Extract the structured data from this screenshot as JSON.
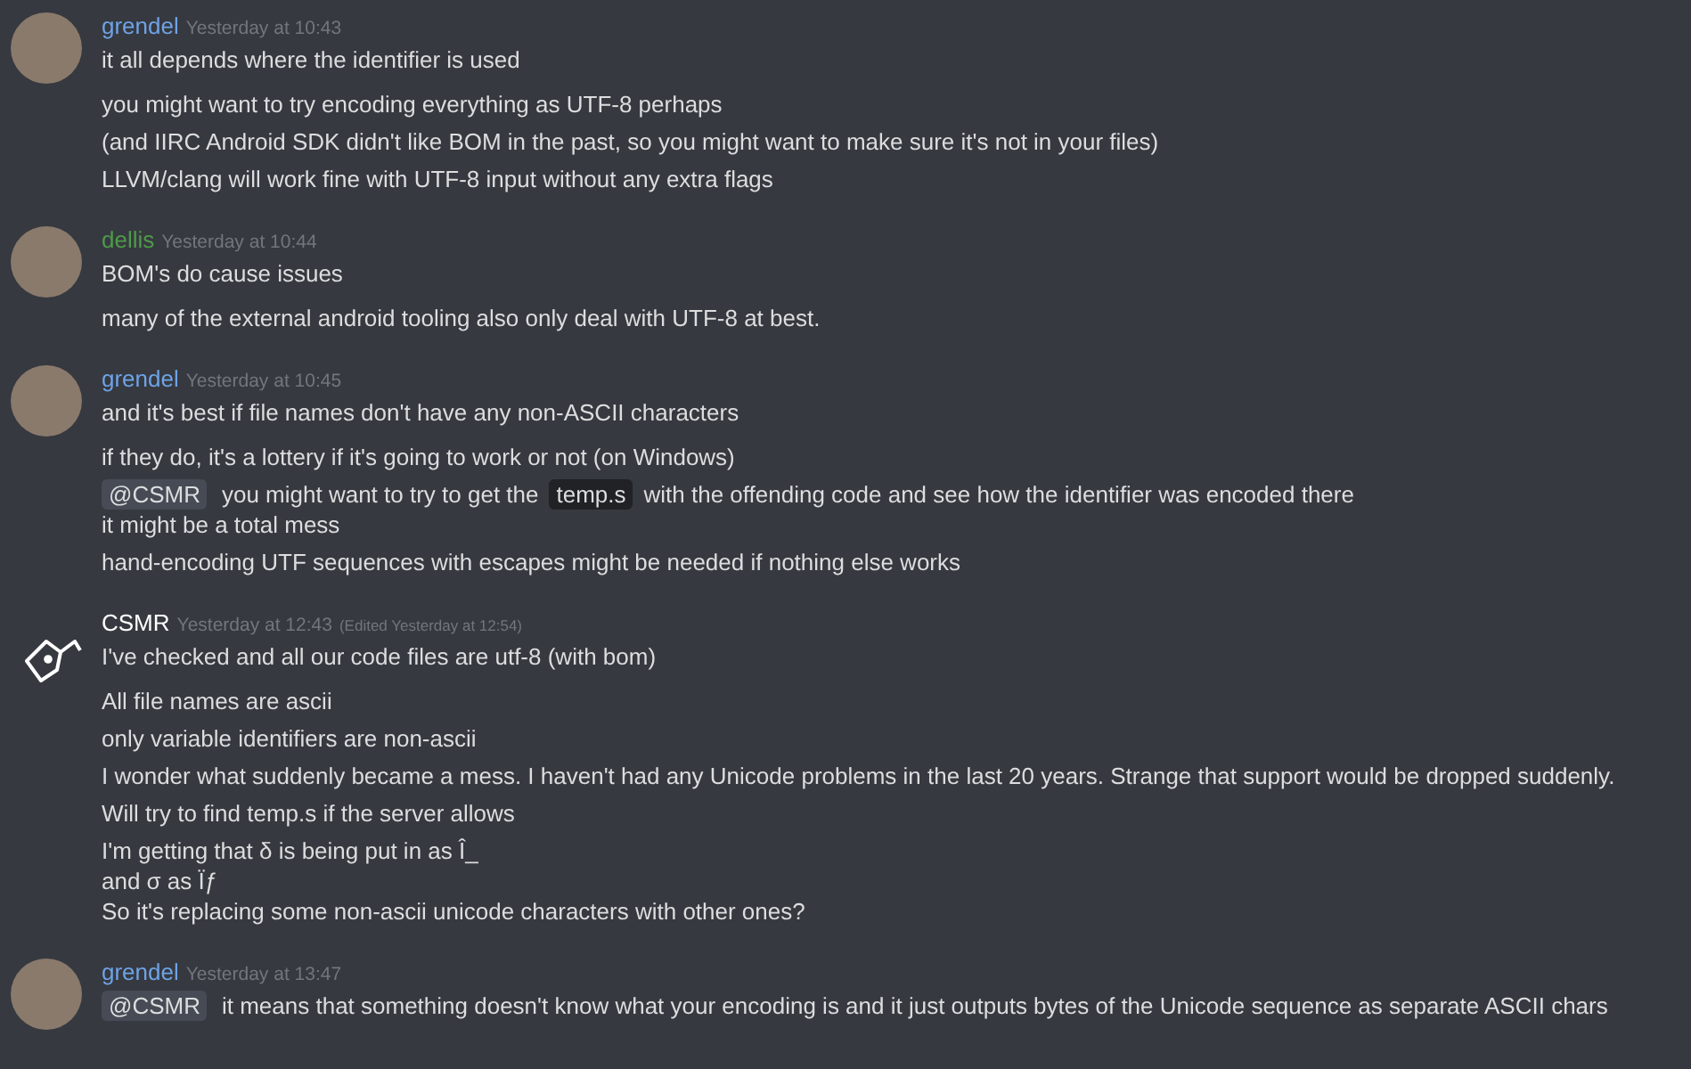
{
  "messages": [
    {
      "author": "grendel",
      "color": "#6ea3e8",
      "avatar": {
        "kind": "photo"
      },
      "timestamp": "Yesterday at 10:43",
      "paragraphs": [
        [
          [
            {
              "kind": "text",
              "text": "it all depends where the identifier is used"
            }
          ]
        ],
        [
          [
            {
              "kind": "text",
              "text": "you might want to try encoding everything as UTF-8 perhaps"
            }
          ]
        ],
        [
          [
            {
              "kind": "text",
              "text": "(and IIRC Android SDK didn't like BOM in the past, so you might want to make sure it's not in your files)"
            }
          ]
        ],
        [
          [
            {
              "kind": "text",
              "text": "LLVM/clang will work fine with UTF-8 input without any extra flags"
            }
          ]
        ]
      ]
    },
    {
      "author": "dellis",
      "color": "#4e9a4a",
      "avatar": {
        "kind": "photo"
      },
      "timestamp": "Yesterday at 10:44",
      "paragraphs": [
        [
          [
            {
              "kind": "text",
              "text": "BOM's do cause issues"
            }
          ]
        ],
        [
          [
            {
              "kind": "text",
              "text": "many of the external android tooling also only deal with UTF-8 at best."
            }
          ]
        ]
      ]
    },
    {
      "author": "grendel",
      "color": "#6ea3e8",
      "avatar": {
        "kind": "photo"
      },
      "timestamp": "Yesterday at 10:45",
      "paragraphs": [
        [
          [
            {
              "kind": "text",
              "text": "and it's best if file names don't have any non-ASCII characters"
            }
          ]
        ],
        [
          [
            {
              "kind": "text",
              "text": "if they do, it's a lottery if it's going to work or not (on Windows)"
            }
          ]
        ],
        [
          [
            {
              "kind": "mention",
              "text": "@CSMR"
            },
            {
              "kind": "text",
              "text": "you might want to try to get the"
            },
            {
              "kind": "code",
              "text": "temp.s"
            },
            {
              "kind": "text",
              "text": "with the offending code and see how the identifier was encoded there"
            }
          ],
          [
            {
              "kind": "text",
              "text": "it might be a total mess"
            }
          ]
        ],
        [
          [
            {
              "kind": "text",
              "text": "hand-encoding UTF sequences with escapes might be needed if nothing else works"
            }
          ]
        ]
      ]
    },
    {
      "author": "CSMR",
      "color": "#ffffff",
      "avatar": {
        "kind": "bird"
      },
      "timestamp": "Yesterday at 12:43",
      "edited": "(Edited Yesterday at 12:54)",
      "paragraphs": [
        [
          [
            {
              "kind": "text",
              "text": "I've checked and all our code files are utf-8 (with bom)"
            }
          ]
        ],
        [
          [
            {
              "kind": "text",
              "text": "All file names are ascii"
            }
          ]
        ],
        [
          [
            {
              "kind": "text",
              "text": "only variable identifiers are non-ascii"
            }
          ]
        ],
        [
          [
            {
              "kind": "text",
              "text": "I wonder what suddenly became a mess. I haven't had any Unicode problems in the last 20 years. Strange that support would be dropped suddenly."
            }
          ]
        ],
        [
          [
            {
              "kind": "text",
              "text": "Will try to find temp.s if the server allows"
            }
          ]
        ],
        [
          [
            {
              "kind": "text",
              "text": "I'm getting that δ is being put in as Î_"
            }
          ],
          [
            {
              "kind": "text",
              "text": "and σ as Ïƒ"
            }
          ],
          [
            {
              "kind": "text",
              "text": "So it's replacing some non-ascii unicode characters with other ones?"
            }
          ]
        ]
      ]
    },
    {
      "author": "grendel",
      "color": "#6ea3e8",
      "avatar": {
        "kind": "photo"
      },
      "timestamp": "Yesterday at 13:47",
      "paragraphs": [
        [
          [
            {
              "kind": "mention",
              "text": "@CSMR"
            },
            {
              "kind": "text",
              "text": "it means that something doesn't know what your encoding is and it just outputs bytes of the Unicode sequence as separate ASCII chars"
            }
          ]
        ]
      ]
    }
  ]
}
